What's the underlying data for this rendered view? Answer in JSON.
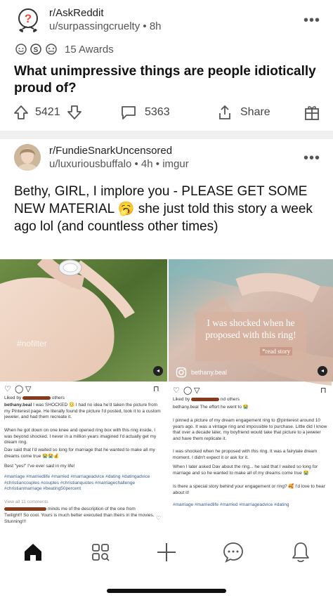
{
  "post1": {
    "subreddit": "r/AskReddit",
    "user": "u/surpassingcruelty",
    "age": "8h",
    "awards_label": "15 Awards",
    "title": "What unimpressive things are people idiotically proud of?",
    "votes": "5421",
    "comments": "5363",
    "share_label": "Share"
  },
  "post2": {
    "subreddit": "r/FundieSnarkUncensored",
    "user": "u/luxuriousbuffalo",
    "age": "4h",
    "source": "imgur",
    "title": "Bethy, GIRL, I implore you - PLEASE GET SOME NEW MATERIAL 🥱 she just told this story a week ago lol (and countless other times)",
    "left_image": {
      "overlay": "#nofilter",
      "liked_by": "Liked by",
      "liked_others": "others",
      "caption_user": "bethany.beal",
      "caption": "I was SHOCKED 😳 I had no idea he'd taken the picture from my Pinterest page. He literally found the picture I'd posted, took it to a custom jeweler, and had them recreate it.",
      "para2": "When he got down on one knee and opened ring box with this ring inside, I was beyond shocked. I never in a million years imagined I'd actually get my dream ring.",
      "para3": "Dav said that I'd waited so long for marriage that he wanted to make all my dreams come true 😭😭💰",
      "para4": "Best \"yes!\" I've ever said in my life!",
      "tags": "#marriage #marriedlife #married #marriageadvice #dating #datingadvice #christiancouples #couples #christianquotes #marriagechallenge #christianmarriage #beating50percent",
      "view_comments": "View all 11 comments",
      "comment1": "minds me of the description of the one from",
      "comment2": "Twilight!! So cool. Yours is much better executed than theirs in the movies. Stunning!!!"
    },
    "right_image": {
      "overlay_line1": "I was shocked when he",
      "overlay_line2": "proposed with this ring!",
      "read_story": "*read story",
      "account": "bethany.beal",
      "liked_by": "Liked by",
      "liked_others": "nd others",
      "caption_user": "bethany.beal",
      "caption": "The effort he went to 😭",
      "para2": "I pinned a picture of my dream engagement ring to @pinterest around 10 years ago. It was a vintage ring and impossible to purchase. Little did I know that over a decade later, my boyfriend would take that picture to a jeweler and have them replicate it.",
      "para3": "I was shocked when he proposed with this ring. It was a fairytale dream moment. I didn't expect it or ask for it.",
      "para4": "When I later asked Dav about the ring... he said that I waited so long for marriage and so he wanted to make all of my dreams come true 😭",
      "para5": "Is there a special story behind your engagement or ring? 🥰 I'd love to hear about it!",
      "tags": "#marriage #marriedlife #married #marriageadvice #dating"
    }
  },
  "nav": {
    "home": "home-icon",
    "communities": "communities-icon",
    "create": "plus-icon",
    "chat": "chat-icon",
    "inbox": "bell-icon"
  }
}
